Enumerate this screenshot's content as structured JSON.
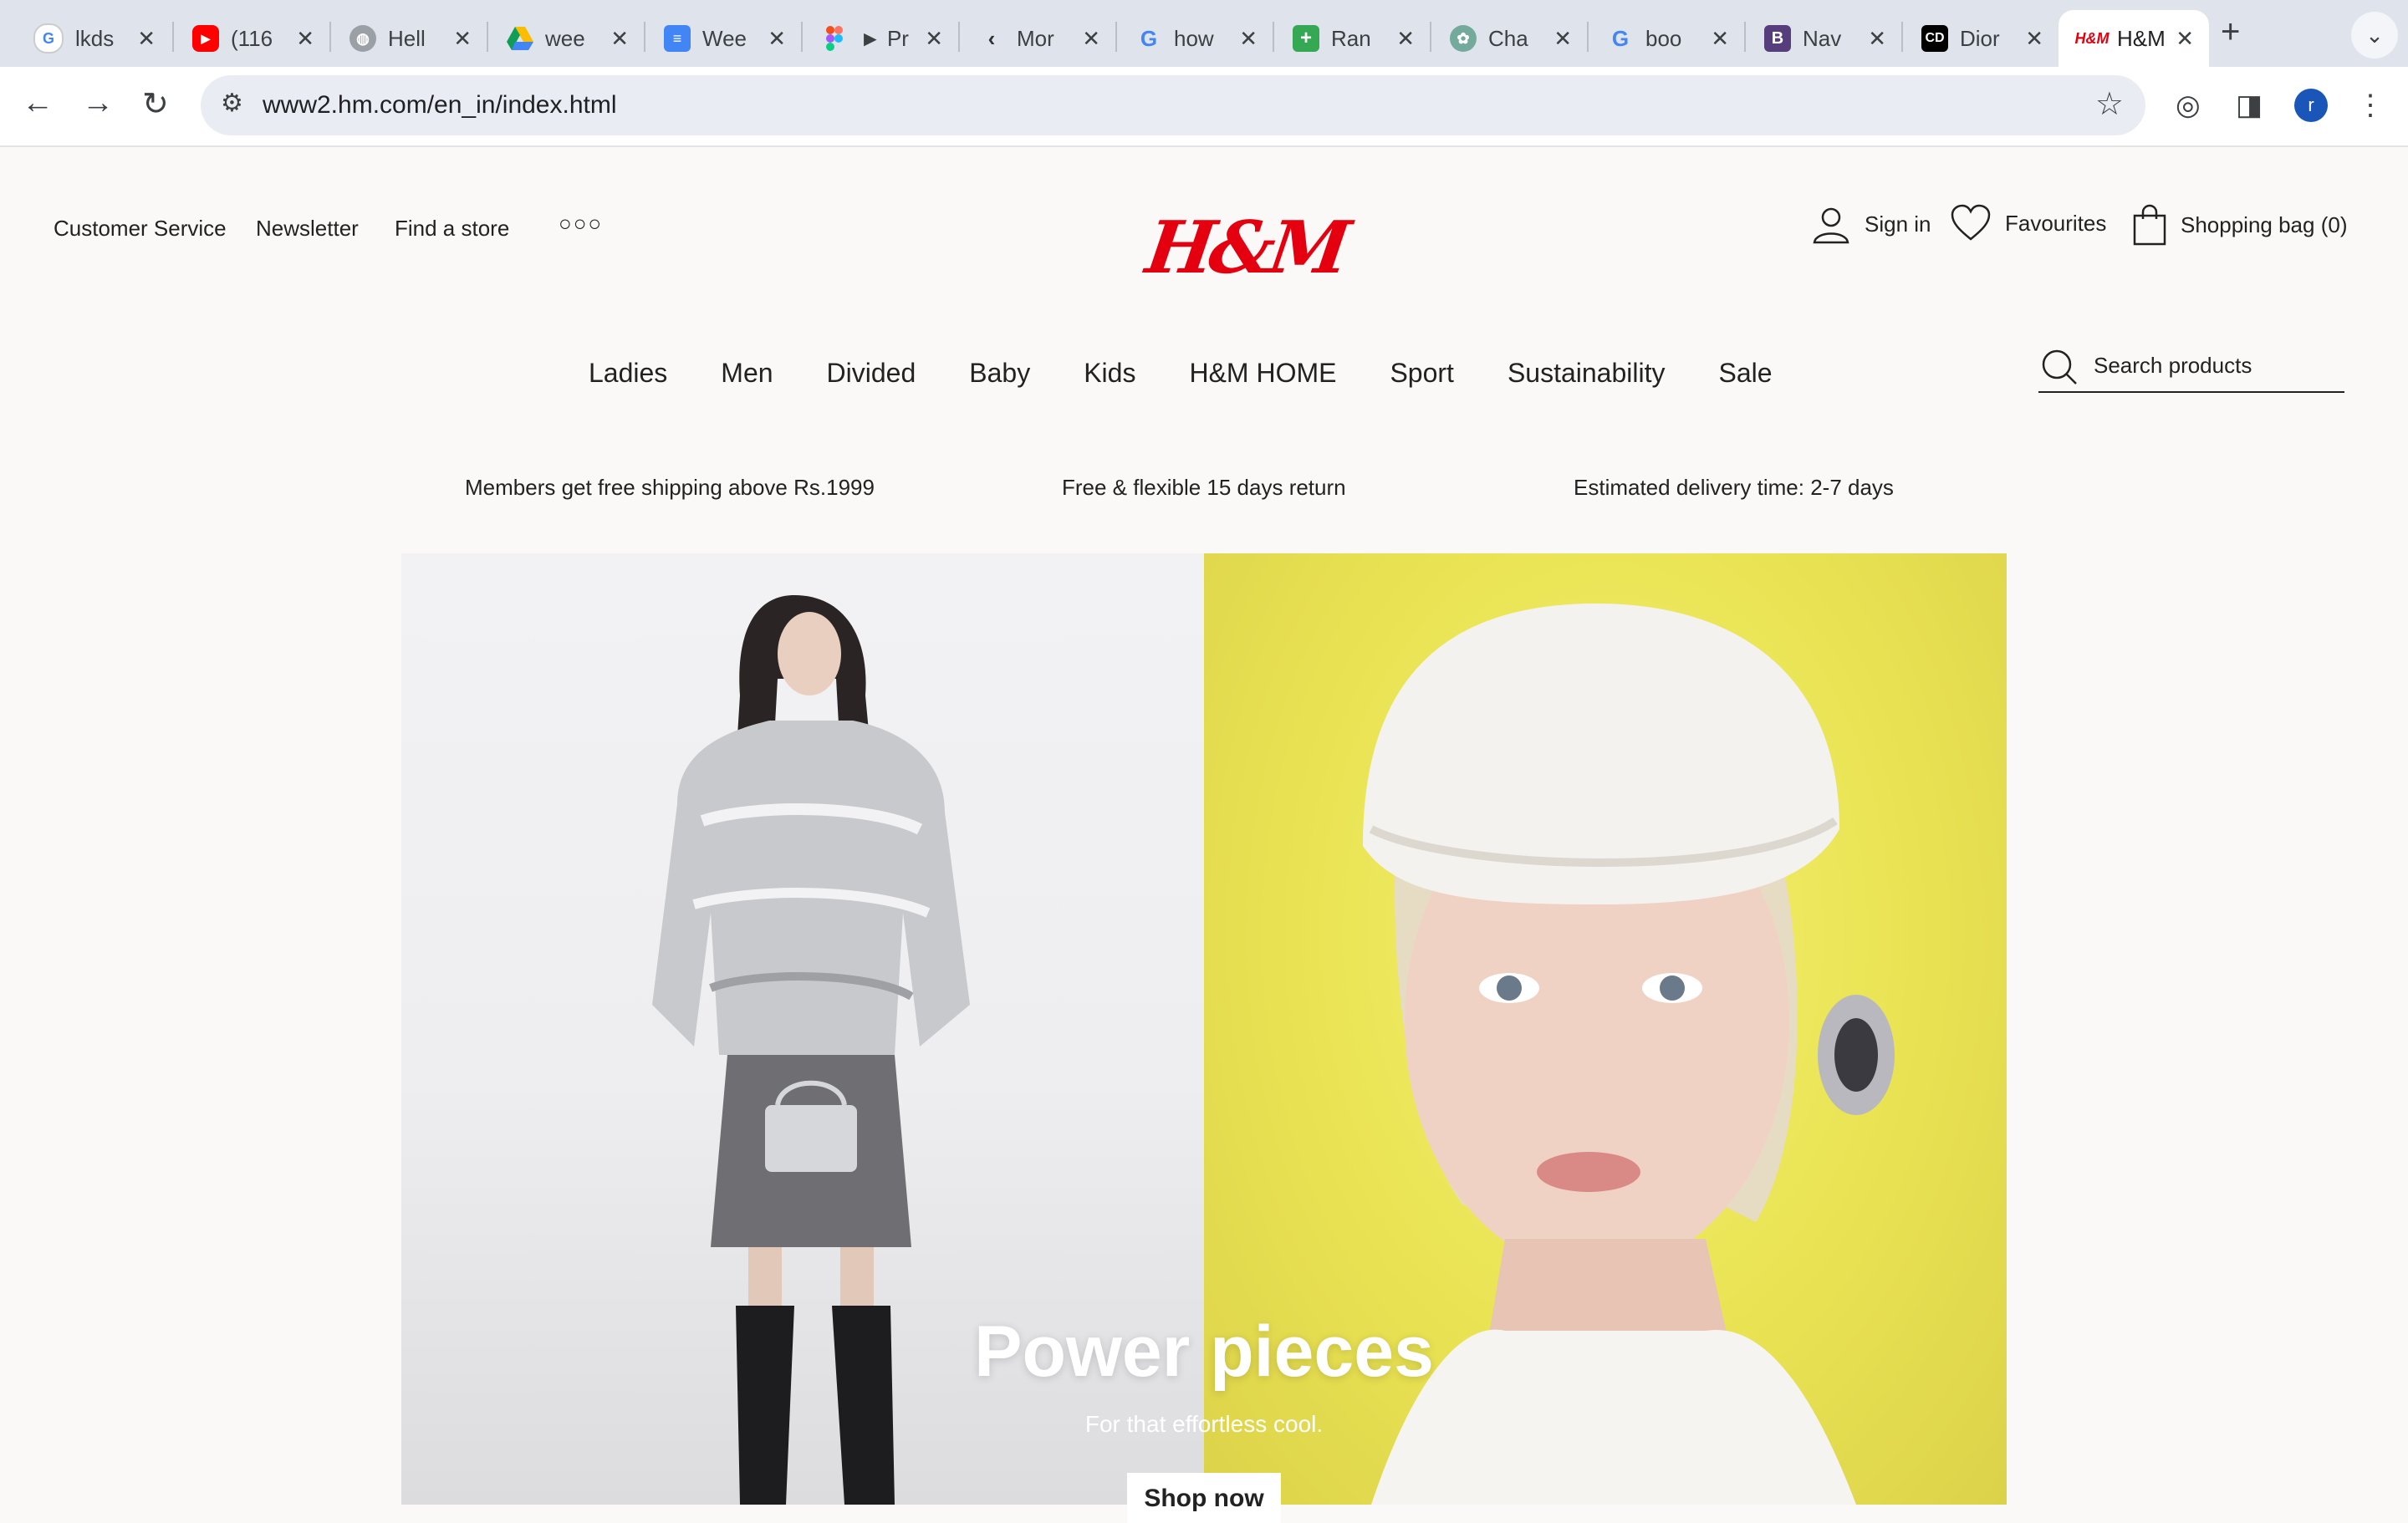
{
  "browser": {
    "tabs": [
      {
        "title": "lkds",
        "favicon": "google-icon",
        "color": "#ffffff"
      },
      {
        "title": "(116",
        "favicon": "youtube-icon",
        "color": "#ff0000"
      },
      {
        "title": "Hell",
        "favicon": "globe-icon",
        "color": "#9aa0a6"
      },
      {
        "title": "wee",
        "favicon": "google-drive-icon",
        "color": "#fbbc04"
      },
      {
        "title": "Wee",
        "favicon": "google-docs-icon",
        "color": "#4285f4"
      },
      {
        "title": "► Pr",
        "favicon": "figma-icon",
        "color": "#f24e1e"
      },
      {
        "title": "Mor",
        "favicon": "monday-icon",
        "color": "#ffffff"
      },
      {
        "title": "how",
        "favicon": "google-icon",
        "color": "#ffffff"
      },
      {
        "title": "Ran",
        "favicon": "google-sheets-icon",
        "color": "#34a853"
      },
      {
        "title": "Cha",
        "favicon": "chatgpt-icon",
        "color": "#74aa9c"
      },
      {
        "title": "boo",
        "favicon": "google-icon",
        "color": "#ffffff"
      },
      {
        "title": "Nav",
        "favicon": "bootstrap-icon",
        "color": "#563d7c"
      },
      {
        "title": "Dior",
        "favicon": "dior-icon",
        "color": "#000000"
      },
      {
        "title": "H&M",
        "favicon": "hm-icon",
        "color": "#ffffff",
        "active": true
      }
    ],
    "url": "www2.hm.com/en_in/index.html",
    "profile_initial": "r"
  },
  "header": {
    "utility_links": [
      "Customer Service",
      "Newsletter",
      "Find a store"
    ],
    "logo": "H&M",
    "sign_in": "Sign in",
    "favourites": "Favourites",
    "shopping_bag": "Shopping bag (0)"
  },
  "nav": {
    "items": [
      "Ladies",
      "Men",
      "Divided",
      "Baby",
      "Kids",
      "H&M HOME",
      "Sport",
      "Sustainability",
      "Sale"
    ],
    "search_placeholder": "Search products"
  },
  "promos": [
    "Members get free shipping above Rs.1999",
    "Free & flexible 15 days return",
    "Estimated delivery time: 2-7 days"
  ],
  "hero": {
    "title": "Power pieces",
    "subtitle": "For that effortless cool.",
    "cta": "Shop now"
  },
  "colors": {
    "brand_red": "#e50010",
    "hero_yellow": "#e9e353"
  }
}
